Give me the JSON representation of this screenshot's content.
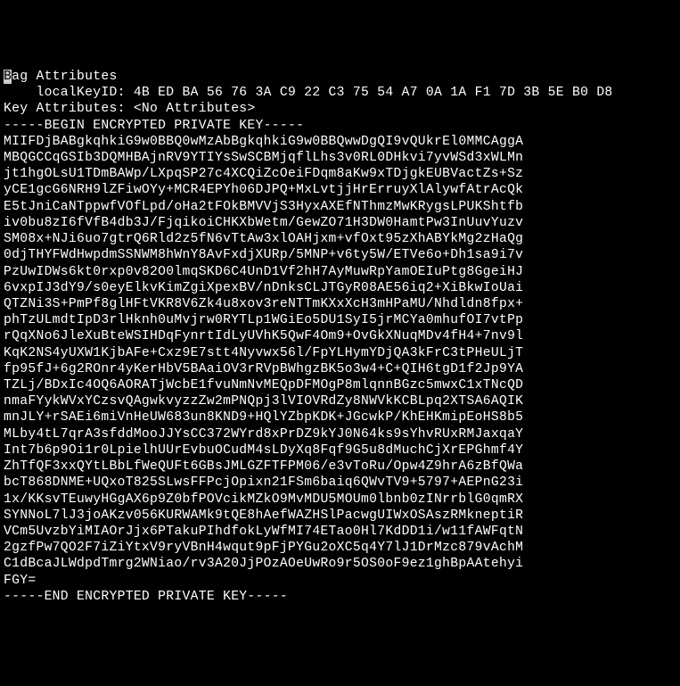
{
  "lines": {
    "line0_prefix_char": "B",
    "line0_rest": "ag Attributes",
    "line1": "    localKeyID: 4B ED BA 56 76 3A C9 22 C3 75 54 A7 0A 1A F1 7D 3B 5E B0 D8 ",
    "line2": "Key Attributes: <No Attributes>",
    "line3": "-----BEGIN ENCRYPTED PRIVATE KEY-----",
    "line4": "MIIFDjBABgkqhkiG9w0BBQ0wMzAbBgkqhkiG9w0BBQwwDgQI9vQUkrEl0MMCAggA",
    "line5": "MBQGCCqGSIb3DQMHBAjnRV9YTIYsSwSCBMjqflLhs3v0RL0DHkvi7yvWSd3xWLMn",
    "line6": "jt1hgOLsU1TDmBAWp/LXpqSP27c4XCQiZcOeiFDqm8aKw9xTDjgkEUBVactZs+Sz",
    "line7": "yCE1gcG6NRH9lZFiwOYy+MCR4EPYh06DJPQ+MxLvtjjHrErruyXlAlywfAtrAcQk",
    "line8": "E5tJniCaNTppwfVOfLpd/oHa2tFOkBMVVjS3HyxAXEfNThmzMwKRygsLPUKShtfb",
    "line9": "iv0bu8zI6fVfB4db3J/FjqikoiCHKXbWetm/GewZO71H3DW0HamtPw3InUuvYuzv",
    "line10": "SM08x+NJi6uo7gtrQ6Rld2z5fN6vTtAw3xlOAHjxm+vfOxt95zXhABYkMg2zHaQg",
    "line11": "0djTHYFWdHwpdmSSNWM8hWnY8AvFxdjXURp/5MNP+v6ty5W/ETVe6o+Dh1sa9i7v",
    "line12": "PzUwIDWs6kt0rxp0v82O0lmqSKD6C4UnD1Vf2hH7AyMuwRpYamOEIuPtg8GgeiHJ",
    "line13": "6vxpIJ3dY9/s0eyElkvKimZgiXpexBV/nDnksCLJTGyR08AE56iq2+XiBkwIoUai",
    "line14": "QTZNi3S+PmPf8glHFtVKR8V6Zk4u8xov3reNTTmKXxXcH3mHPaMU/Nhdldn8fpx+",
    "line15": "phTzULmdtIpD3rlHknh0uMvjrw0RYTLp1WGiEo5DU1SyI5jrMCYa0mhufOI7vtPp",
    "line16": "rQqXNo6JleXuBteWSIHDqFynrtIdLyUVhK5QwF4Om9+OvGkXNuqMDv4fH4+7nv9l",
    "line17": "KqK2NS4yUXW1KjbAFe+Cxz9E7stt4Nyvwx56l/FpYLHymYDjQA3kFrC3tPHeULjT",
    "line18": "fp95fJ+6g2ROnr4yKerHbV5BAaiOV3rRVpBWhgzBK5o3w4+C+QIH6tgD1f2Jp9YA",
    "line19": "TZLj/BDxIc4OQ6AORATjWcbE1fvuNmNvMEQpDFMOgP8mlqnnBGzc5mwxC1xTNcQD",
    "line20": "nmaFYykWVxYCzsvQAgwkvyzzZw2mPNQpj3lVIOVRdZy8NWVkKCBLpq2XTSA6AQIK",
    "line21": "mnJLY+rSAEi6miVnHeUW683un8KND9+HQlYZbpKDK+JGcwkP/KhEHKmipEoHS8b5",
    "line22": "MLby4tL7qrA3sfddMooJJYsCC372WYrd8xPrDZ9kYJ0N64ks9sYhvRUxRMJaxqaY",
    "line23": "Int7b6p9Oi1r0LpielhUUrEvbuOCudM4sLDyXq8Fqf9G5u8dMuchCjXrEPGhmf4Y",
    "line24": "ZhTfQF3xxQYtLBbLfWeQUFt6GBsJMLGZFTFPM06/e3vToRu/Opw4Z9hrA6zBfQWa",
    "line25": "bcT868DNME+UQxoT825SLwsFFPcjOpixn21FSm6baiq6QWvTV9+5797+AEPnG23i",
    "line26": "1x/KKsvTEuwyHGgAX6p9Z0bfPOVcikMZkO9MvMDU5MOUm0lbnb0zINrrblG0qmRX",
    "line27": "SYNNoL7lJ3joAKzv056KURWAMk9tQE8hAefWAZHSlPacwgUIWxOSAszRMkneptiR",
    "line28": "VCm5UvzbYiMIAOrJjx6PTakuPIhdfokLyWfMI74ETao0Hl7KdDD1i/w11fAWFqtN",
    "line29": "2gzfPw7QO2F7iZiYtxV9ryVBnH4wqut9pFjPYGu2oXC5q4Y7lJ1DrMzc879vAchM",
    "line30": "C1dBcaJLWdpdTmrg2WNiao/rv3A20JjPOzAOeUwRo9r5OS0oF9ez1ghBpAAtehyi",
    "line31": "FGY=",
    "line32": "-----END ENCRYPTED PRIVATE KEY-----"
  }
}
